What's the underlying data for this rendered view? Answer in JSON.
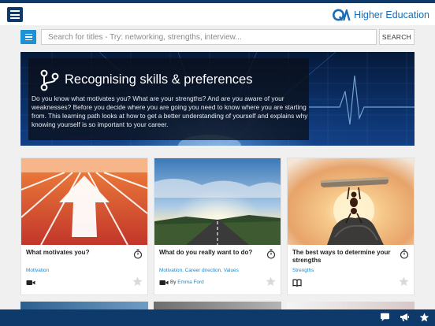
{
  "header": {
    "brand_text": "Higher Education",
    "menu_icon": "hamburger-menu-icon",
    "brand_color": "#1a6bb5",
    "bar_color": "#0d3a6b"
  },
  "search": {
    "placeholder": "Search for titles - Try: networking, strengths, interview...",
    "button_label": "SEARCH"
  },
  "hero": {
    "title": "Recognising skills & preferences",
    "description": "Do you know what motivates you? What are your strengths? And are you aware of your weaknesses? Before you decide where you are going you need to know where you are starting from. This learning path looks at how to get a better understanding of yourself and explains why knowing yourself is so important to your career.",
    "icon": "learning-path-icon"
  },
  "cards": [
    {
      "title": "What motivates you?",
      "tags": "Motivation",
      "type_icon": "video-icon",
      "by": "",
      "author": ""
    },
    {
      "title": "What do you really want to do?",
      "tags": "Motivation, Career direction, Values",
      "type_icon": "video-icon",
      "by": "By",
      "author": "Emma Ford"
    },
    {
      "title": "The best ways to determine your strengths",
      "tags": "Strengths",
      "type_icon": "book-icon",
      "by": "",
      "author": ""
    }
  ],
  "bottom_bar": {
    "icons": [
      "chat-icon",
      "megaphone-icon",
      "star-icon"
    ]
  },
  "colors": {
    "accent": "#1e90d6",
    "link": "#1e88d0"
  }
}
